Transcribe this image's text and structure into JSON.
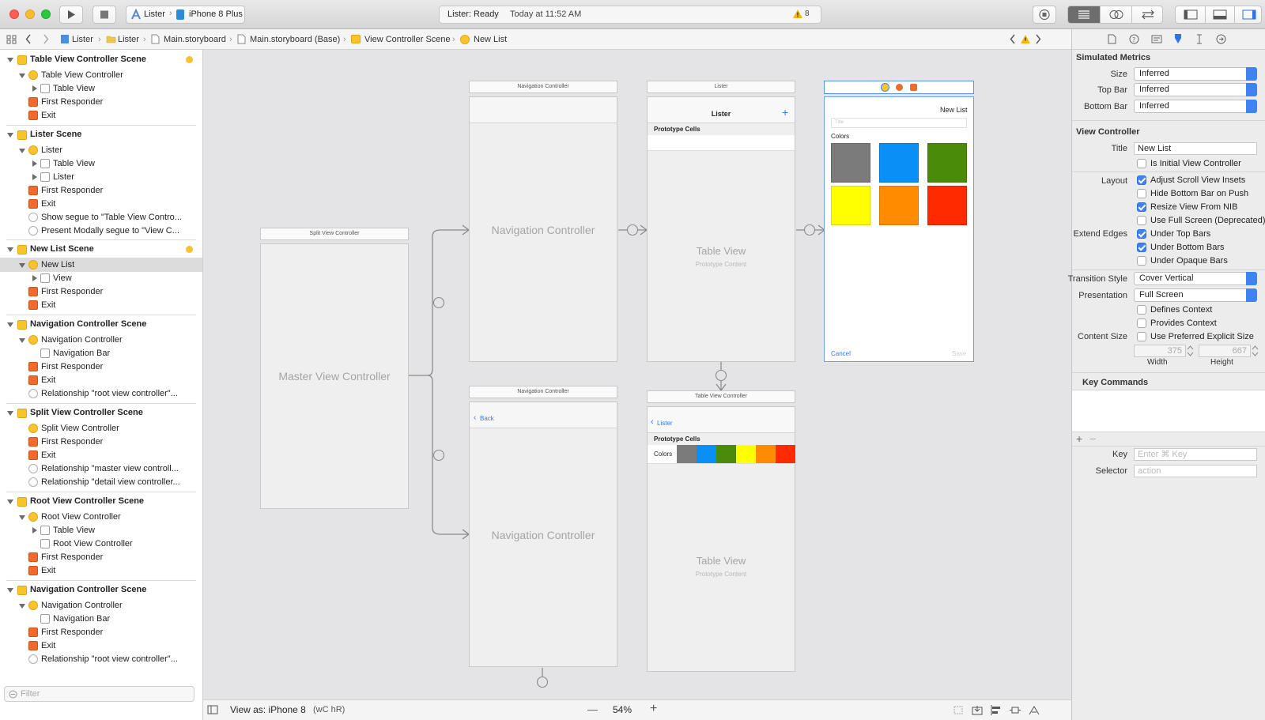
{
  "toolbar": {
    "scheme_app": "Lister",
    "scheme_device": "iPhone 8 Plus",
    "status_text": "Lister: Ready",
    "status_time": "Today at 11:52 AM",
    "warning_count": "8"
  },
  "jumpbar": {
    "crumbs": [
      "Lister",
      "Lister",
      "Main.storyboard",
      "Main.storyboard (Base)",
      "View Controller Scene",
      "New List"
    ]
  },
  "outline": {
    "scenes": [
      {
        "title": "Table View Controller Scene",
        "items": [
          "Table View Controller",
          "Table View",
          "First Responder",
          "Exit"
        ]
      },
      {
        "title": "Lister Scene",
        "items": [
          "Lister",
          "Table View",
          "Lister",
          "First Responder",
          "Exit",
          "Show segue to \"Table View Contro...",
          "Present Modally segue to \"View C..."
        ]
      },
      {
        "title": "New List Scene",
        "items": [
          "New List",
          "View",
          "First Responder",
          "Exit"
        ]
      },
      {
        "title": "Navigation Controller Scene",
        "items": [
          "Navigation Controller",
          "Navigation Bar",
          "First Responder",
          "Exit",
          "Relationship \"root view controller\"..."
        ]
      },
      {
        "title": "Split View Controller Scene",
        "items": [
          "Split View Controller",
          "First Responder",
          "Exit",
          "Relationship \"master view controll...",
          "Relationship \"detail view controller..."
        ]
      },
      {
        "title": "Root View Controller Scene",
        "items": [
          "Root View Controller",
          "Table View",
          "Root View Controller",
          "First Responder",
          "Exit"
        ]
      },
      {
        "title": "Navigation Controller Scene",
        "items": [
          "Navigation Controller",
          "Navigation Bar",
          "First Responder",
          "Exit",
          "Relationship \"root view controller\"..."
        ]
      }
    ],
    "filter_placeholder": "Filter"
  },
  "canvas": {
    "split_title": "Split View Controller",
    "master_label": "Master View Controller",
    "nav1_title": "Navigation Controller",
    "nav1_label": "Navigation Controller",
    "nav2_title": "Navigation Controller",
    "nav2_label": "Navigation Controller",
    "nav2_back": "Back",
    "lister_title": "Lister",
    "lister_nav": "Lister",
    "lister_plus": "+",
    "prototype_cells": "Prototype Cells",
    "table_view": "Table View",
    "prototype_content": "Prototype Content",
    "tvc_title": "Table View Controller",
    "tvc_back": "Lister",
    "tvc_prototype": "Prototype Cells",
    "tvc_colors": "Colors",
    "table_view2": "Table View",
    "prototype_content2": "Prototype Content",
    "newlist_nav": "New List",
    "newlist_field_placeholder": "Title",
    "newlist_colors": "Colors",
    "newlist_cancel": "Cancel",
    "newlist_save": "Save",
    "swatch_colors": [
      "#7b7b7b",
      "#0a8ff7",
      "#4a8c0a",
      "#ffff00",
      "#ff8c00",
      "#ff2a00"
    ]
  },
  "bottombar": {
    "view_as": "View as: iPhone 8",
    "size_class": "(wC hR)",
    "zoom": "54%",
    "minus": "—",
    "plus": "+"
  },
  "inspector": {
    "simulated_metrics": "Simulated Metrics",
    "size_label": "Size",
    "size_value": "Inferred",
    "topbar_label": "Top Bar",
    "topbar_value": "Inferred",
    "bottombar_label": "Bottom Bar",
    "bottombar_value": "Inferred",
    "view_controller": "View Controller",
    "title_label": "Title",
    "title_value": "New List",
    "is_initial": "Is Initial View Controller",
    "layout_label": "Layout",
    "adjust_scroll": "Adjust Scroll View Insets",
    "hide_bottom": "Hide Bottom Bar on Push",
    "resize_nib": "Resize View From NIB",
    "full_screen": "Use Full Screen (Deprecated)",
    "extend_label": "Extend Edges",
    "under_top": "Under Top Bars",
    "under_bottom": "Under Bottom Bars",
    "under_opaque": "Under Opaque Bars",
    "transition_label": "Transition Style",
    "transition_value": "Cover Vertical",
    "presentation_label": "Presentation",
    "presentation_value": "Full Screen",
    "defines_context": "Defines Context",
    "provides_context": "Provides Context",
    "content_size_label": "Content Size",
    "preferred_size": "Use Preferred Explicit Size",
    "width_value": "375",
    "height_value": "667",
    "width_label": "Width",
    "height_label": "Height",
    "key_commands": "Key Commands",
    "key_label": "Key",
    "key_placeholder": "Enter ⌘ Key",
    "selector_label": "Selector",
    "selector_placeholder": "action"
  },
  "colors": {
    "accent": "#3f83f2",
    "canvas_bg": "#e4e4e6"
  }
}
